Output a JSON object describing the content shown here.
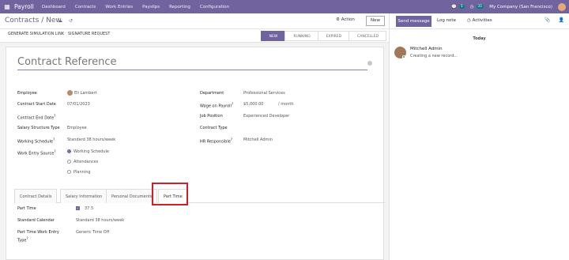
{
  "topbar": {
    "app_name": "Payroll",
    "menu": [
      "Dashboard",
      "Contracts",
      "Work Entries",
      "Payslips",
      "Reporting",
      "Configuration"
    ],
    "msg_count": "5",
    "activity_count": "31",
    "company": "My Company (San Francisco)",
    "accent": "#71639e"
  },
  "control": {
    "breadcrumb": "Contracts / New",
    "action_label": "Action",
    "new_label": "New"
  },
  "statusbar": {
    "buttons": [
      "GENERATE SIMULATION LINK",
      "SIGNATURE REQUEST"
    ],
    "stages": [
      "NEW",
      "RUNNING",
      "EXPIRED",
      "CANCELLED"
    ],
    "active_stage": "NEW"
  },
  "form": {
    "title_placeholder": "Contract Reference",
    "left": [
      {
        "label": "Employee",
        "value": "Eli Lambert"
      },
      {
        "label": "Contract Start Date",
        "value": "07/01/2023"
      },
      {
        "label": "Contract End Date",
        "value": ""
      },
      {
        "label": "Salary Structure Type",
        "value": "Employee"
      },
      {
        "label": "Working Schedule",
        "value": "Standard 38 hours/week"
      },
      {
        "label": "Work Entry Source",
        "value": ""
      }
    ],
    "right": [
      {
        "label": "Department",
        "value": "Professional Services"
      },
      {
        "label": "Wage on Payroll",
        "value": "$5,000.00"
      },
      {
        "label": "Job Position",
        "value": "Experienced Developer"
      },
      {
        "label": "Contract Type",
        "value": ""
      },
      {
        "label": "HR Responsible",
        "value": "Mitchell Admin"
      }
    ],
    "wage_period": "/ month",
    "work_entry_options": [
      "Working Schedule",
      "Attendances",
      "Planning"
    ],
    "tabs": [
      "Contract Details",
      "Salary Information",
      "Personal Documents",
      "Part Time"
    ],
    "active_tab": "Part Time",
    "part_time": {
      "fields": [
        {
          "label": "Part Time",
          "value": "37.5"
        },
        {
          "label": "Standard Calendar",
          "value": "Standard 38 hours/week"
        },
        {
          "label": "Part Time Work Entry Type",
          "value": "Generic Time Off"
        }
      ]
    }
  },
  "chatter": {
    "send_message": "Send message",
    "log_note": "Log note",
    "activities": "Activities",
    "day_label": "Today",
    "author": "Mitchell Admin",
    "message": "Creating a new record..."
  }
}
